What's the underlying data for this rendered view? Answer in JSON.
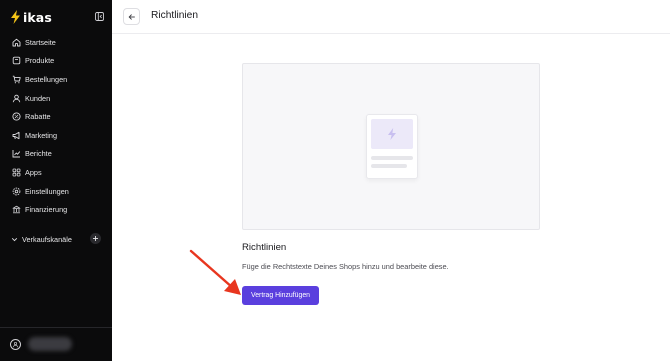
{
  "brand": {
    "name": "ikas",
    "accent": "#f5c518"
  },
  "sidebar": {
    "items": [
      {
        "label": "Startseite",
        "icon": "home-icon"
      },
      {
        "label": "Produkte",
        "icon": "tag-icon"
      },
      {
        "label": "Bestellungen",
        "icon": "cart-icon"
      },
      {
        "label": "Kunden",
        "icon": "user-icon"
      },
      {
        "label": "Rabatte",
        "icon": "percent-icon"
      },
      {
        "label": "Marketing",
        "icon": "megaphone-icon"
      },
      {
        "label": "Berichte",
        "icon": "chart-icon"
      },
      {
        "label": "Apps",
        "icon": "apps-icon"
      },
      {
        "label": "Einstellungen",
        "icon": "gear-icon"
      },
      {
        "label": "Finanzierung",
        "icon": "bank-icon"
      }
    ],
    "channels_label": "Verkaufskanäle"
  },
  "header": {
    "title": "Richtlinien"
  },
  "main": {
    "section_title": "Richtlinien",
    "description": "Füge die Rechtstexte Deines Shops hinzu und bearbeite diese.",
    "add_button_label": "Vertrag Hinzufügen"
  },
  "colors": {
    "primary": "#5a3fde",
    "sidebar_bg": "#0b0b0c",
    "annotation_arrow": "#e8361f"
  }
}
